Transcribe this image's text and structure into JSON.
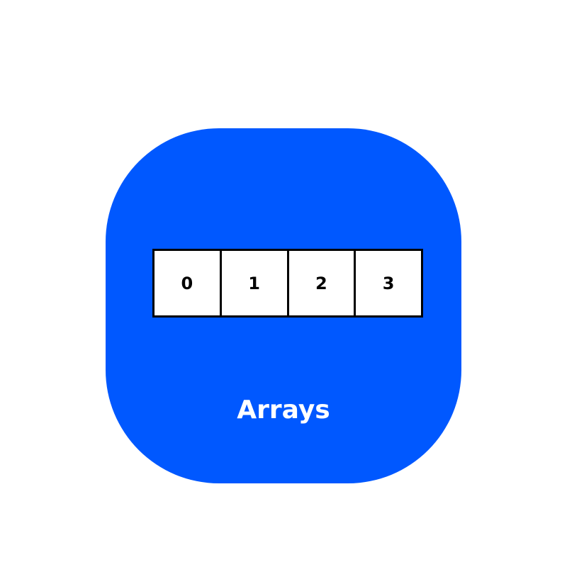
{
  "tile": {
    "background_color": "#0058FF",
    "label": "Arrays"
  },
  "array": {
    "cells": [
      "0",
      "1",
      "2",
      "3"
    ],
    "cell_background": "#ffffff",
    "border_color": "#000000"
  }
}
